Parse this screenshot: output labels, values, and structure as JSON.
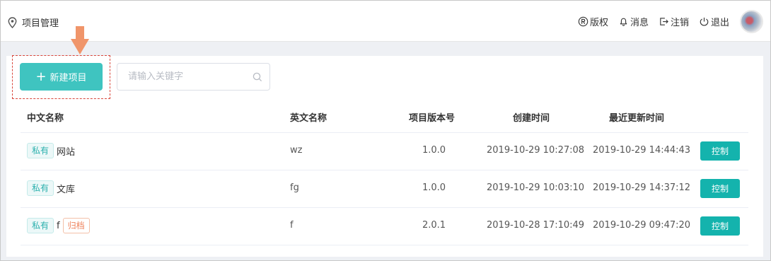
{
  "header": {
    "location_icon": "map-pin-icon",
    "title": "项目管理",
    "nav": [
      {
        "icon": "registered-icon",
        "label": "版权"
      },
      {
        "icon": "bell-icon",
        "label": "消息"
      },
      {
        "icon": "logout-arrow-icon",
        "label": "注销"
      },
      {
        "icon": "power-icon",
        "label": "退出"
      }
    ],
    "avatar": "user-avatar"
  },
  "toolbar": {
    "new_button": "新建项目",
    "search_placeholder": "请输入关键字",
    "search_value": ""
  },
  "table": {
    "columns": [
      "中文名称",
      "英文名称",
      "项目版本号",
      "创建时间",
      "最近更新时间"
    ],
    "rows": [
      {
        "tag": "私有",
        "name": "网站",
        "archived": "",
        "en": "wz",
        "version": "1.0.0",
        "created": "2019-10-29 10:27:08",
        "updated": "2019-10-29 14:44:43",
        "action": "控制"
      },
      {
        "tag": "私有",
        "name": "文库",
        "archived": "",
        "en": "fg",
        "version": "1.0.0",
        "created": "2019-10-29 10:03:10",
        "updated": "2019-10-29 14:37:12",
        "action": "控制"
      },
      {
        "tag": "私有",
        "name": "f",
        "archived": "归档",
        "en": "f",
        "version": "2.0.1",
        "created": "2019-10-28 17:10:49",
        "updated": "2019-10-29 09:47:20",
        "action": "控制"
      }
    ]
  },
  "colors": {
    "accent": "#3fc4c0",
    "control_button": "#14b3ad",
    "annotation": "#f0956a",
    "archive_tag": "#ef8560"
  }
}
